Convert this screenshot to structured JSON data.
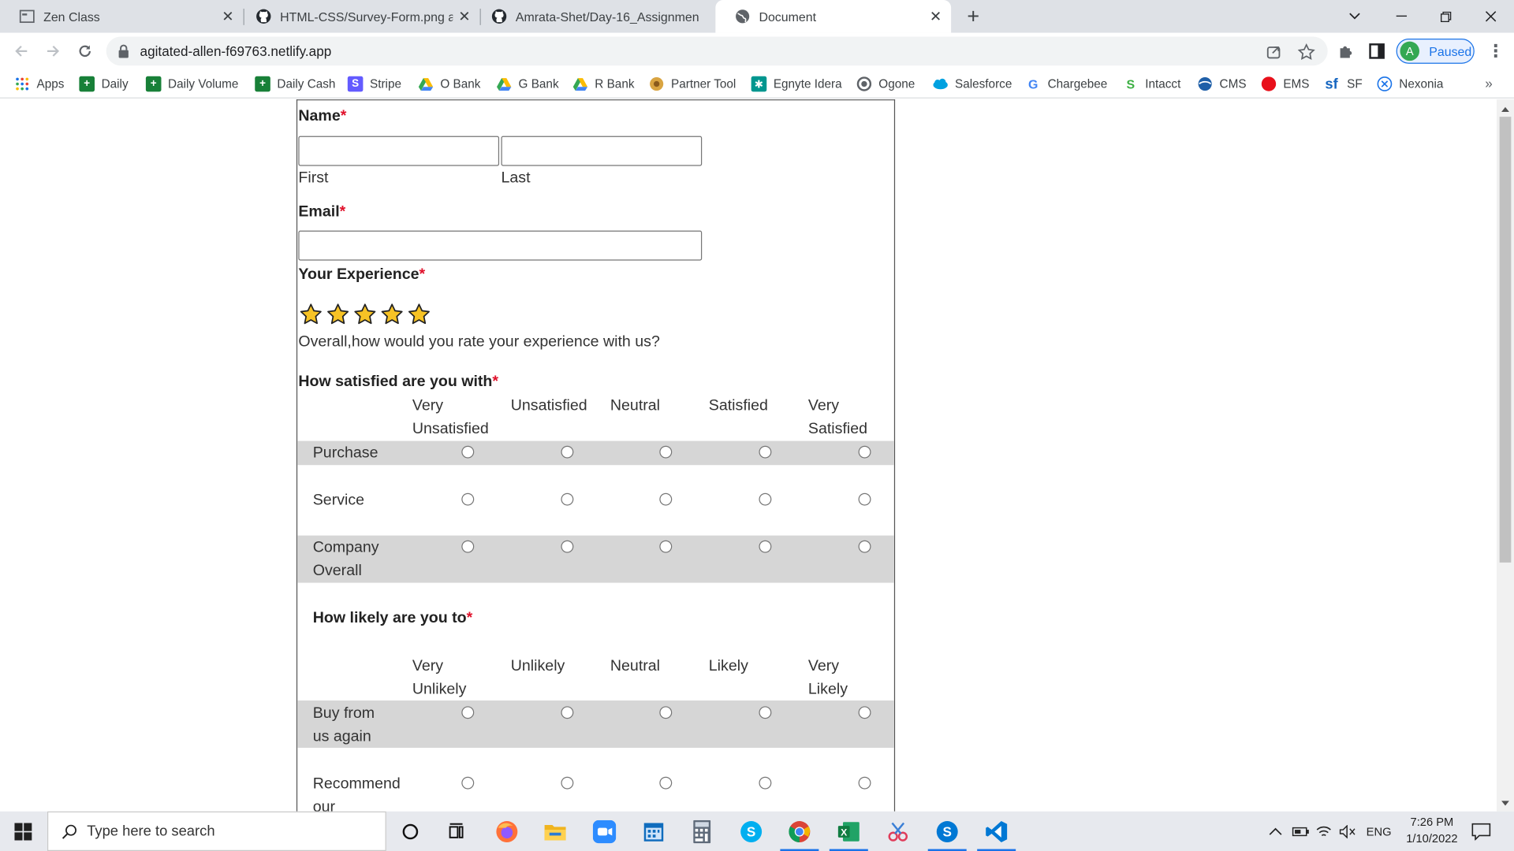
{
  "browser": {
    "tabs": [
      {
        "title": "Zen Class",
        "icon": "zen-icon",
        "active": false
      },
      {
        "title": "HTML-CSS/Survey-Form.png at m",
        "icon": "github-icon",
        "active": false
      },
      {
        "title": "Amrata-Shet/Day-16_Assignmen",
        "icon": "github-icon",
        "active": false
      },
      {
        "title": "Document",
        "icon": "globe-icon",
        "active": true
      }
    ],
    "url": "agitated-allen-f69763.netlify.app",
    "profile_initial": "A",
    "profile_status": "Paused"
  },
  "bookmarks": [
    {
      "label": "Apps",
      "icon": "apps-grid-icon"
    },
    {
      "label": "Daily",
      "icon": "sheets-icon"
    },
    {
      "label": "Daily Volume",
      "icon": "sheets-icon"
    },
    {
      "label": "Daily Cash",
      "icon": "sheets-icon"
    },
    {
      "label": "Stripe",
      "icon": "stripe-icon"
    },
    {
      "label": "O Bank",
      "icon": "drive-icon"
    },
    {
      "label": "G Bank",
      "icon": "drive-icon"
    },
    {
      "label": "R Bank",
      "icon": "drive-icon"
    },
    {
      "label": "Partner Tool",
      "icon": "partner-icon"
    },
    {
      "label": "Egnyte Idera",
      "icon": "egnyte-icon"
    },
    {
      "label": "Ogone",
      "icon": "ogone-icon"
    },
    {
      "label": "Salesforce",
      "icon": "salesforce-icon"
    },
    {
      "label": "Chargebee",
      "icon": "google-icon"
    },
    {
      "label": "Intacct",
      "icon": "intacct-icon"
    },
    {
      "label": "CMS",
      "icon": "cms-icon"
    },
    {
      "label": "EMS",
      "icon": "ems-icon"
    },
    {
      "label": "SF",
      "icon": "sf-icon"
    },
    {
      "label": "Nexonia",
      "icon": "nexonia-icon"
    }
  ],
  "form": {
    "name_label": "Name",
    "required_mark": "*",
    "first_caption": "First",
    "last_caption": "Last",
    "email_label": "Email",
    "experience_label": "Your Experience",
    "rating": 5,
    "rating_max": 5,
    "experience_question": "Overall,how would you rate your experience with us?",
    "satisfied": {
      "heading": "How satisfied are you with",
      "columns": [
        "Very Unsatisfied",
        "Unsatisfied",
        "Neutral",
        "Satisfied",
        "Very Satisfied"
      ],
      "rows": [
        "Purchase",
        "Service",
        "Company Overall"
      ]
    },
    "likely": {
      "heading": "How likely are you to",
      "columns": [
        "Very Unlikely",
        "Unlikely",
        "Neutral",
        "Likely",
        "Very Likely"
      ],
      "rows": [
        "Buy from us again",
        "Recommend our"
      ]
    }
  },
  "taskbar": {
    "search_placeholder": "Type here to search",
    "apps": [
      "cortana-icon",
      "task-view-icon",
      "firefox-icon",
      "file-explorer-icon",
      "zoom-icon",
      "calendar-icon",
      "calculator-icon",
      "skype-icon",
      "chrome-icon",
      "excel-icon",
      "snipping-icon",
      "skype-business-icon",
      "vscode-icon"
    ],
    "language": "ENG",
    "time": "7:26 PM",
    "date": "1/10/2022"
  },
  "colors": {
    "required": "#e0102a",
    "row_band": "#d6d6d6",
    "star_fill": "#f7c325",
    "accent": "#1a73e8"
  }
}
